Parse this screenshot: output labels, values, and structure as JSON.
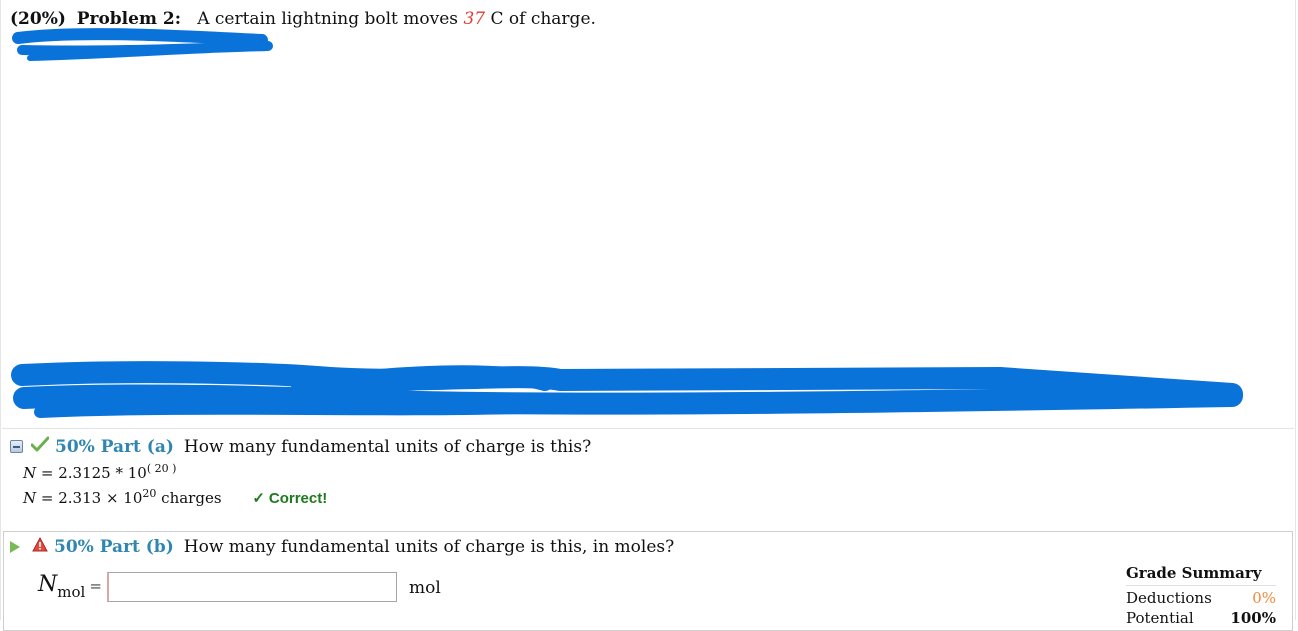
{
  "problem": {
    "weight": "(20%)",
    "label": "Problem 2:",
    "text_before": "A certain lightning bolt moves",
    "charge": "37",
    "text_after": "C of charge."
  },
  "part_a": {
    "percent_label": "50% Part (a)",
    "question": "How many fundamental units of charge is this?",
    "submitted_symbol": "N",
    "submitted_value": "= 2.3125 * 10",
    "submitted_exp": "( 20 )",
    "answer_symbol": "N",
    "answer_value": "= 2.313 × 10",
    "answer_exp": "20",
    "answer_unit": "charges",
    "status": "Correct!",
    "status_color": "#1e7a1e"
  },
  "part_b": {
    "percent_label": "50% Part (b)",
    "question": "How many fundamental units of charge is this, in moles?",
    "var_symbol": "N",
    "var_subscript": "mol",
    "equals": "=",
    "input_value": "",
    "unit": "mol"
  },
  "grade_summary": {
    "title": "Grade Summary",
    "deductions_label": "Deductions",
    "deductions_value": "0%",
    "potential_label": "Potential",
    "potential_value": "100%"
  },
  "colors": {
    "accent": "#2f86b0",
    "redaction": "#0a73d9",
    "charge_highlight": "#e03c31",
    "deductions": "#f2883a"
  },
  "icons": {
    "collapse": "collapse-icon",
    "checkmark": "checkmark-icon",
    "play": "play-icon",
    "warning": "warning-icon"
  }
}
